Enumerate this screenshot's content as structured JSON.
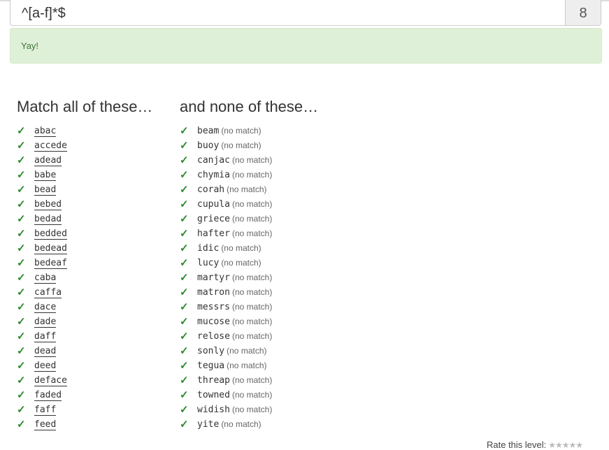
{
  "regex": {
    "value": "^[a-f]*$",
    "char_count": "8"
  },
  "alert": {
    "text": "Yay!"
  },
  "match_heading": "Match all of these…",
  "nomatch_heading": "and none of these…",
  "check_glyph": "✓",
  "match_words": [
    "abac",
    "accede",
    "adead",
    "babe",
    "bead",
    "bebed",
    "bedad",
    "bedded",
    "bedead",
    "bedeaf",
    "caba",
    "caffa",
    "dace",
    "dade",
    "daff",
    "dead",
    "deed",
    "deface",
    "faded",
    "faff",
    "feed"
  ],
  "nomatch_words": [
    "beam",
    "buoy",
    "canjac",
    "chymia",
    "corah",
    "cupula",
    "griece",
    "hafter",
    "idic",
    "lucy",
    "martyr",
    "matron",
    "messrs",
    "mucose",
    "relose",
    "sonly",
    "tegua",
    "threap",
    "towned",
    "widish",
    "yite"
  ],
  "no_match_note": "(no match)",
  "rating": {
    "label": "Rate this level:",
    "stars": "★★★★★"
  },
  "colors": {
    "check": "#2b8a2b",
    "alert_bg": "#dff0d8",
    "alert_text": "#3c763d"
  }
}
